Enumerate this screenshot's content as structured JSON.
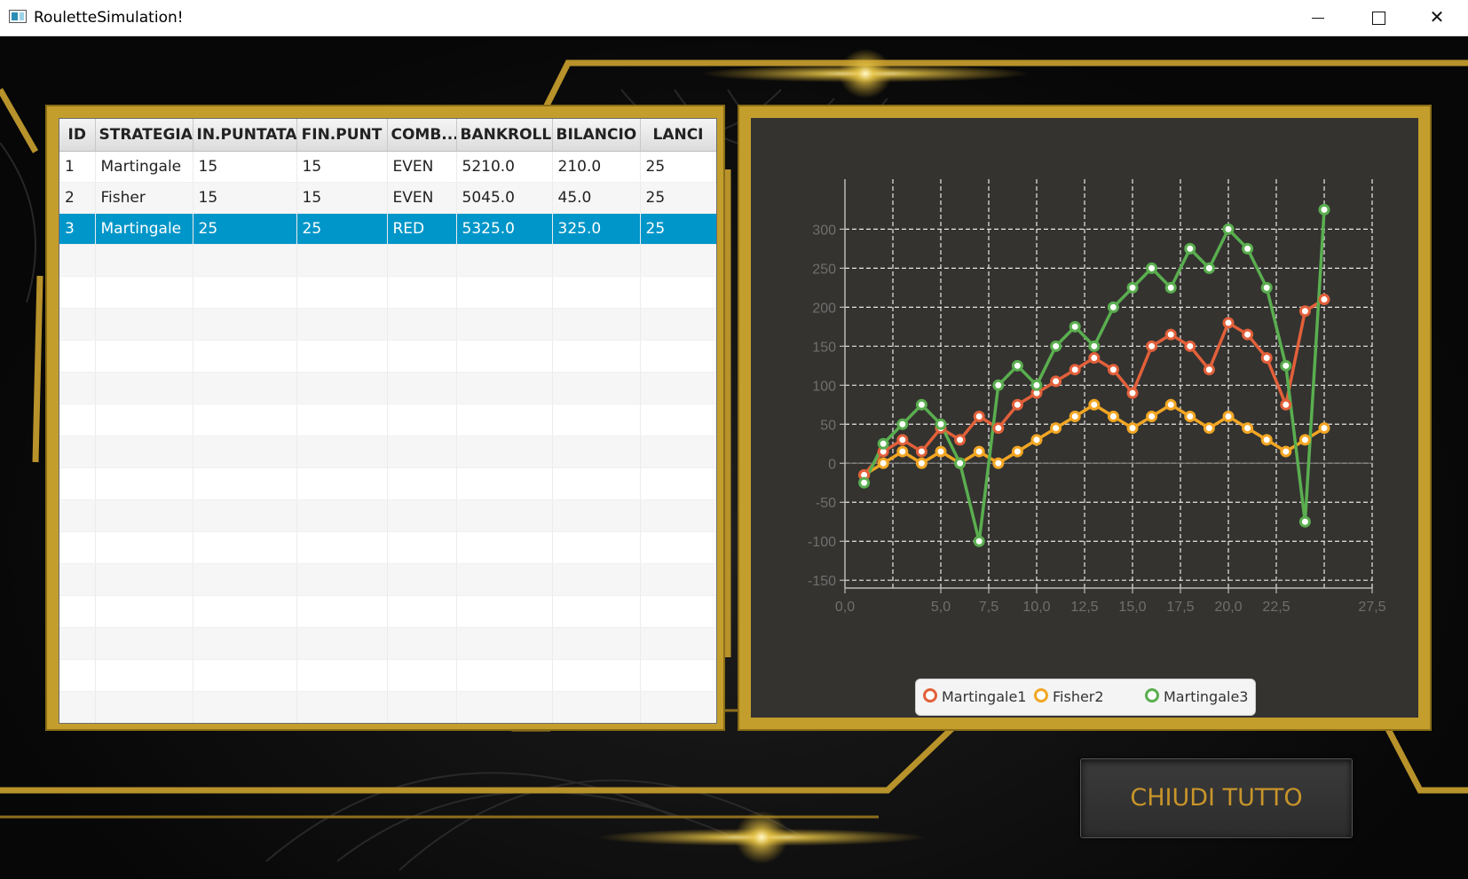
{
  "window": {
    "title": "RouletteSimulation!",
    "controls": [
      "minimize",
      "maximize",
      "close"
    ]
  },
  "table": {
    "columns": [
      "ID",
      "STRATEGIA",
      "IN.PUNTATA",
      "FIN.PUNT",
      "COMB...",
      "BANKROLL",
      "BILANCIO",
      "LANCI"
    ],
    "rows": [
      [
        "1",
        "Martingale",
        "15",
        "15",
        "EVEN",
        "5210.0",
        "210.0",
        "25"
      ],
      [
        "2",
        "Fisher",
        "15",
        "15",
        "EVEN",
        "5045.0",
        "45.0",
        "25"
      ],
      [
        "3",
        "Martingale",
        "25",
        "25",
        "RED",
        "5325.0",
        "325.0",
        "25"
      ]
    ],
    "selected_row": 2,
    "empty_rows": 15
  },
  "chart_data": {
    "type": "line",
    "x_ticks": [
      "0,0",
      "5,0",
      "7,5",
      "10,0",
      "12,5",
      "15,0",
      "17,5",
      "20,0",
      "22,5",
      "27,5"
    ],
    "y_ticks": [
      "300",
      "250",
      "200",
      "150",
      "100",
      "50",
      "0",
      "-50",
      "-100",
      "-150"
    ],
    "xlim": [
      0,
      27.5
    ],
    "ylim": [
      -150,
      300
    ],
    "grid": true,
    "legend_position": "bottom",
    "series": [
      {
        "name": "Martingale1",
        "color": "#e2603a",
        "x": [
          1,
          2,
          3,
          4,
          5,
          6,
          7,
          8,
          9,
          10,
          11,
          12,
          13,
          14,
          15,
          16,
          17,
          18,
          19,
          20,
          21,
          22,
          23,
          24,
          25
        ],
        "y": [
          -15,
          15,
          30,
          15,
          45,
          30,
          60,
          45,
          75,
          90,
          105,
          120,
          135,
          120,
          90,
          150,
          165,
          150,
          120,
          180,
          165,
          135,
          75,
          195,
          210
        ]
      },
      {
        "name": "Fisher2",
        "color": "#f2a623",
        "x": [
          1,
          2,
          3,
          4,
          5,
          6,
          7,
          8,
          9,
          10,
          11,
          12,
          13,
          14,
          15,
          16,
          17,
          18,
          19,
          20,
          21,
          22,
          23,
          24,
          25
        ],
        "y": [
          -15,
          0,
          15,
          0,
          15,
          0,
          15,
          0,
          15,
          30,
          45,
          60,
          75,
          60,
          45,
          60,
          75,
          60,
          45,
          60,
          45,
          30,
          15,
          30,
          45
        ]
      },
      {
        "name": "Martingale3",
        "color": "#5aae4f",
        "x": [
          1,
          2,
          3,
          4,
          5,
          6,
          7,
          8,
          9,
          10,
          11,
          12,
          13,
          14,
          15,
          16,
          17,
          18,
          19,
          20,
          21,
          22,
          23,
          24,
          25
        ],
        "y": [
          -25,
          25,
          50,
          75,
          50,
          0,
          -100,
          100,
          125,
          100,
          150,
          175,
          150,
          200,
          225,
          250,
          225,
          275,
          250,
          300,
          275,
          225,
          125,
          -75,
          325
        ]
      }
    ]
  },
  "buttons": {
    "close_all": "CHIUDI TUTTO"
  },
  "theme": {
    "gold": "#c49e2c",
    "selection": "#0096c9",
    "button_text": "#c8952a"
  }
}
